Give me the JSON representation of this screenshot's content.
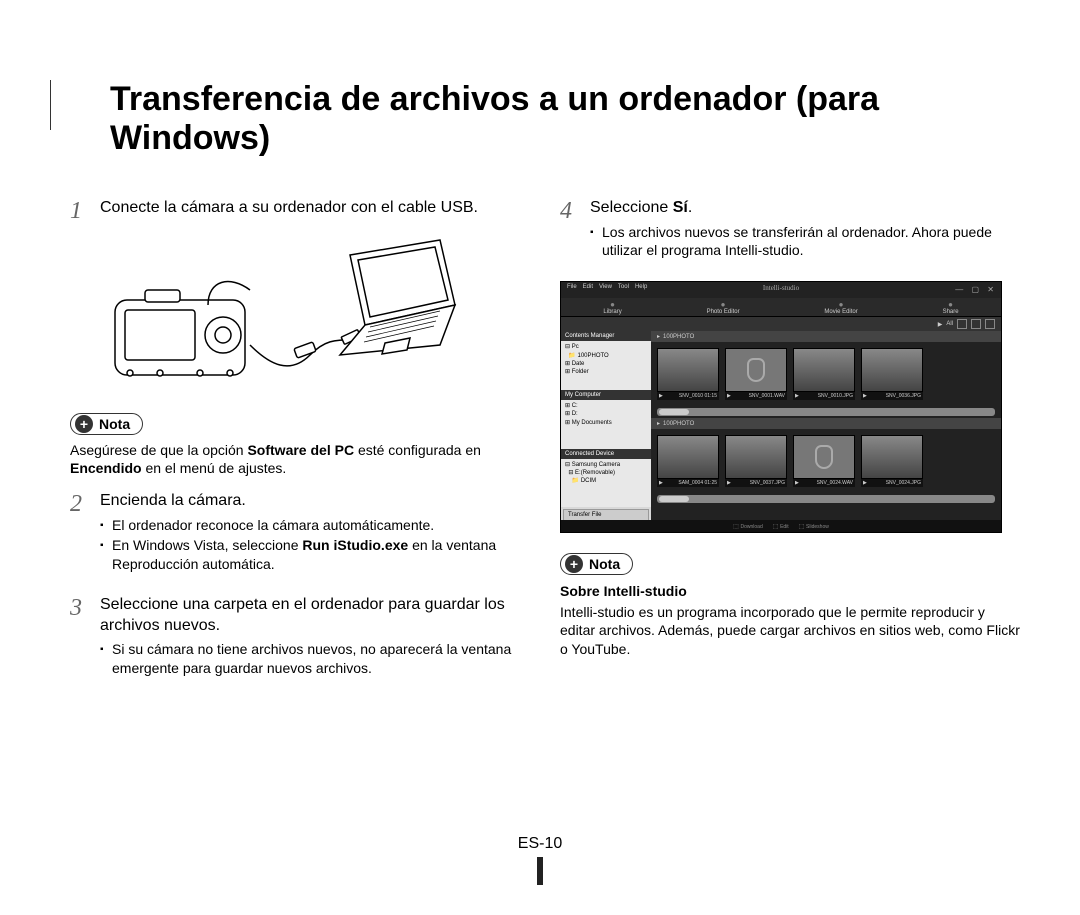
{
  "title": "Transferencia de archivos a un ordenador (para Windows)",
  "page_number": "ES-10",
  "nota_label": "Nota",
  "left": {
    "step1_num": "1",
    "step1_text": "Conecte la cámara a su ordenador con el cable USB.",
    "nota1_a": "Asegúrese de que la opción ",
    "nota1_b": "Software del PC",
    "nota1_c": " esté configurada en ",
    "nota1_d": "Encendido",
    "nota1_e": " en el menú de ajustes.",
    "step2_num": "2",
    "step2_text": "Encienda la cámara.",
    "step2_bullet1": "El ordenador reconoce la cámara automáticamente.",
    "step2_bullet2a": "En Windows Vista, seleccione ",
    "step2_bullet2b": "Run iStudio.exe",
    "step2_bullet2c": " en la ventana Reproducción automática.",
    "step3_num": "3",
    "step3_text": "Seleccione una carpeta en el ordenador para guardar los archivos nuevos.",
    "step3_bullet1": "Si su cámara no tiene archivos nuevos, no aparecerá la ventana emergente para guardar nuevos archivos."
  },
  "right": {
    "step4_num": "4",
    "step4_a": "Seleccione ",
    "step4_b": "Sí",
    "step4_c": ".",
    "step4_bullet1": "Los archivos nuevos se transferirán al ordenador. Ahora puede utilizar el programa Intelli-studio.",
    "nota2_head": "Sobre Intelli-studio",
    "nota2_text": "Intelli-studio es un programa incorporado que le permite reproducir y editar archivos. Además, puede cargar archivos en sitios web, como Flickr o YouTube."
  },
  "screenshot": {
    "app_title": "Intelli-studio",
    "menus": [
      "File",
      "Edit",
      "View",
      "Tool",
      "Help"
    ],
    "tabs": [
      "Library",
      "Photo Editor",
      "Movie Editor",
      "Share"
    ],
    "subbar_all": "All",
    "sidebar": {
      "contents_header": "Contents Manager",
      "pc_tree": [
        "Pc",
        "100PHOTO",
        "Date",
        "Folder"
      ],
      "mycomputer_header": "My Computer",
      "mycomputer_tree": [
        "C:",
        "D:",
        "My Documents"
      ],
      "connected_header": "Connected Device",
      "connected_tree": [
        "Samsung Camera",
        "E:(Removable)",
        "DCIM"
      ],
      "transfer_btn": "Transfer File"
    },
    "folders": [
      "100PHOTO",
      "100PHOTO"
    ],
    "thumbs_top": [
      "SNV_0010   01:15",
      "SNV_0001.WAV",
      "SNV_0010.JPG",
      "SNV_0036.JPG"
    ],
    "thumbs_bottom": [
      "SAM_0004   01:25",
      "SNV_0037.JPG",
      "SNV_0024.WAV",
      "SNV_0024.JPG"
    ],
    "footer_items": [
      "Download",
      "Edit",
      "Slideshow"
    ]
  }
}
